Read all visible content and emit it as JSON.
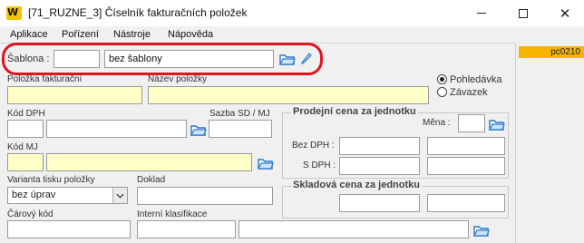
{
  "window": {
    "logo_text": "W",
    "title": "[71_RUZNE_3] Číselník fakturačních položek",
    "close_glyph": "✕"
  },
  "menu": {
    "items": [
      "Aplikace",
      "Pořízení",
      "Nástroje",
      "Nápověda"
    ]
  },
  "side": {
    "badge": "pc0210"
  },
  "template": {
    "label": "Šablona :",
    "code_value": "",
    "name_value": "bez šablony"
  },
  "form": {
    "polozka_label": "Položka fakturační",
    "nazev_label": "Název položky",
    "radio_options": [
      {
        "label": "Pohledávka",
        "selected": true
      },
      {
        "label": "Závazek",
        "selected": false
      }
    ],
    "kod_dph_label": "Kód DPH",
    "sazba_label": "Sazba SD / MJ",
    "kod_mj_label": "Kód MJ",
    "varianta_label": "Varianta tisku položky",
    "varianta_value": "bez úprav",
    "doklad_label": "Doklad",
    "carovy_label": "Čárový kód",
    "interni_label": "Interní klasifikace"
  },
  "prodejni": {
    "title": "Prodejní cena za jednotku",
    "mena_label": "Měna :",
    "bez_dph_label": "Bez DPH :",
    "s_dph_label": "S DPH :"
  },
  "skladova": {
    "title": "Skladová cena za jednotku"
  },
  "colors": {
    "required_field": "#ffffc8",
    "badge": "#f5b400",
    "highlight_ring": "#e0141e"
  }
}
